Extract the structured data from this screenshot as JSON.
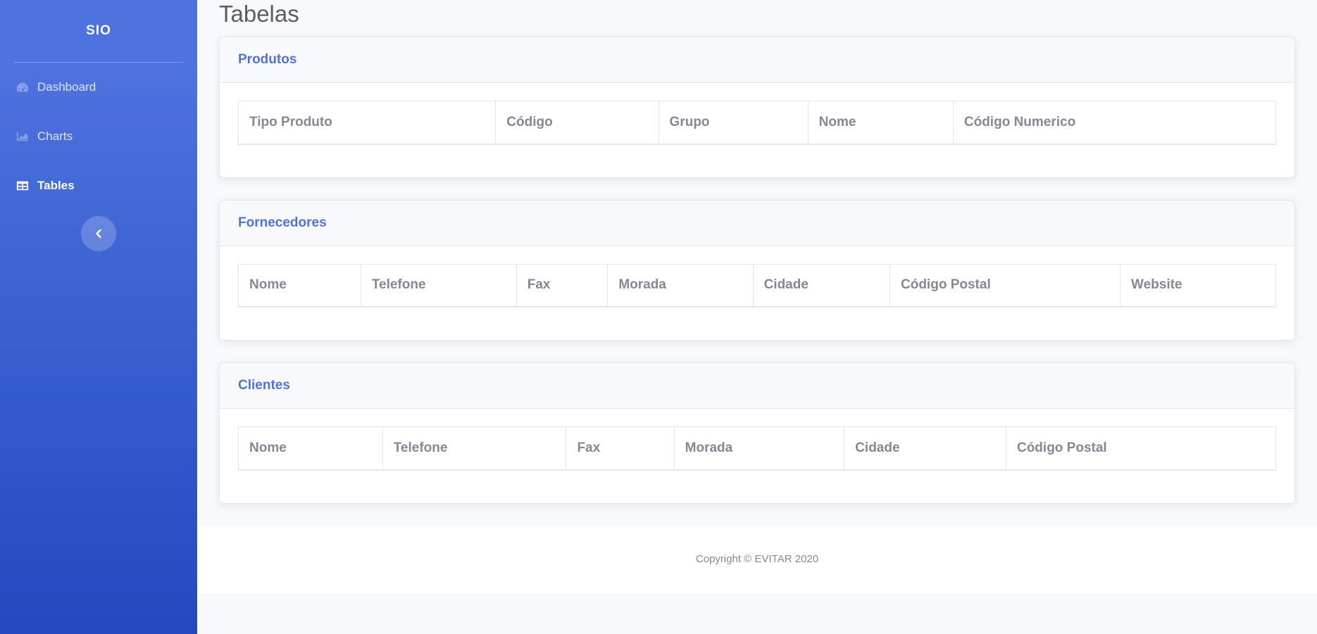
{
  "sidebar": {
    "brand": "SIO",
    "items": [
      {
        "label": "Dashboard",
        "icon": "tachometer-icon",
        "active": false
      },
      {
        "label": "Charts",
        "icon": "area-chart-icon",
        "active": false
      },
      {
        "label": "Tables",
        "icon": "table-icon",
        "active": true
      }
    ],
    "toggle_icon": "chevron-left-icon"
  },
  "page": {
    "title": "Tabelas"
  },
  "cards": [
    {
      "title": "Produtos",
      "columns": [
        "Tipo Produto",
        "Código",
        "Grupo",
        "Nome",
        "Código Numerico"
      ]
    },
    {
      "title": "Fornecedores",
      "columns": [
        "Nome",
        "Telefone",
        "Fax",
        "Morada",
        "Cidade",
        "Código Postal",
        "Website"
      ]
    },
    {
      "title": "Clientes",
      "columns": [
        "Nome",
        "Telefone",
        "Fax",
        "Morada",
        "Cidade",
        "Código Postal"
      ]
    }
  ],
  "footer": {
    "copyright": "Copyright © EVITAR 2020"
  },
  "colors": {
    "primary": "#4e73df",
    "sidebar_bottom": "#224abe",
    "text_muted": "#858796",
    "title": "#5a5c69"
  }
}
